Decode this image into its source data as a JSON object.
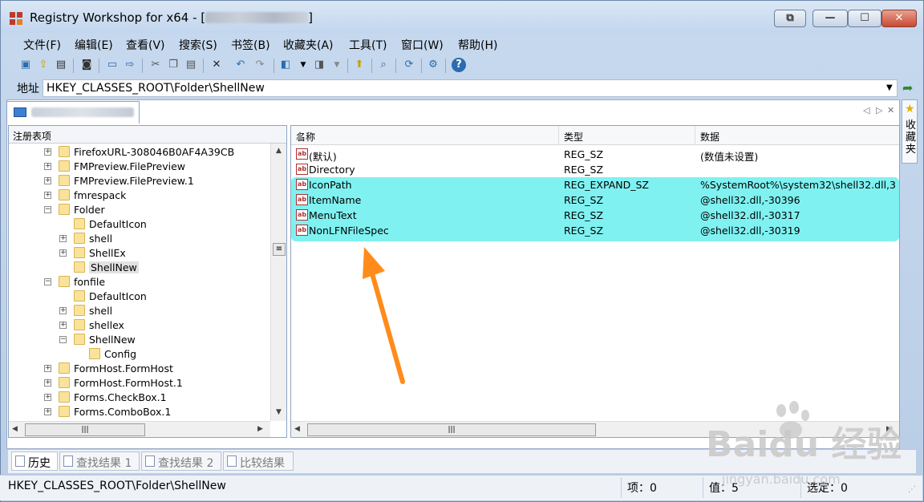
{
  "window": {
    "title": "Registry Workshop for x64 - [",
    "title_suffix": "]"
  },
  "menu": [
    "文件(F)",
    "编辑(E)",
    "查看(V)",
    "搜索(S)",
    "书签(B)",
    "收藏夹(A)",
    "工具(T)",
    "窗口(W)",
    "帮助(H)"
  ],
  "address": {
    "label": "地址",
    "value": "HKEY_CLASSES_ROOT\\Folder\\ShellNew"
  },
  "favorites": {
    "label": "收藏夹"
  },
  "tree": {
    "header": "注册表项",
    "items": [
      {
        "label": "FirefoxURL-308046B0AF4A39CB",
        "level": 0,
        "expander": "+"
      },
      {
        "label": "FMPreview.FilePreview",
        "level": 0,
        "expander": "+"
      },
      {
        "label": "FMPreview.FilePreview.1",
        "level": 0,
        "expander": "+"
      },
      {
        "label": "fmrespack",
        "level": 0,
        "expander": "+"
      },
      {
        "label": "Folder",
        "level": 0,
        "expander": "-"
      },
      {
        "label": "DefaultIcon",
        "level": 1,
        "expander": ""
      },
      {
        "label": "shell",
        "level": 1,
        "expander": "+"
      },
      {
        "label": "ShellEx",
        "level": 1,
        "expander": "+"
      },
      {
        "label": "ShellNew",
        "level": 1,
        "expander": "",
        "selected": true
      },
      {
        "label": "fonfile",
        "level": 0,
        "expander": "-"
      },
      {
        "label": "DefaultIcon",
        "level": 1,
        "expander": ""
      },
      {
        "label": "shell",
        "level": 1,
        "expander": "+"
      },
      {
        "label": "shellex",
        "level": 1,
        "expander": "+"
      },
      {
        "label": "ShellNew",
        "level": 1,
        "expander": "-"
      },
      {
        "label": "Config",
        "level": 2,
        "expander": ""
      },
      {
        "label": "FormHost.FormHost",
        "level": 0,
        "expander": "+"
      },
      {
        "label": "FormHost.FormHost.1",
        "level": 0,
        "expander": "+"
      },
      {
        "label": "Forms.CheckBox.1",
        "level": 0,
        "expander": "+"
      },
      {
        "label": "Forms.ComboBox.1",
        "level": 0,
        "expander": "+"
      }
    ]
  },
  "list": {
    "columns": [
      "名称",
      "类型",
      "数据"
    ],
    "rows": [
      {
        "name": "(默认)",
        "type": "REG_SZ",
        "data": "(数值未设置)"
      },
      {
        "name": "Directory",
        "type": "REG_SZ",
        "data": ""
      },
      {
        "name": "IconPath",
        "type": "REG_EXPAND_SZ",
        "data": "%SystemRoot%\\system32\\shell32.dll,3"
      },
      {
        "name": "ItemName",
        "type": "REG_SZ",
        "data": "@shell32.dll,-30396"
      },
      {
        "name": "MenuText",
        "type": "REG_SZ",
        "data": "@shell32.dll,-30317"
      },
      {
        "name": "NonLFNFileSpec",
        "type": "REG_SZ",
        "data": "@shell32.dll,-30319"
      }
    ]
  },
  "bottom_tabs": [
    "历史",
    "查找结果 1",
    "查找结果 2",
    "比较结果"
  ],
  "status": {
    "path": "HKEY_CLASSES_ROOT\\Folder\\ShellNew",
    "keys": "项：0",
    "values": "值：5",
    "selected": "选定：0"
  },
  "watermark": {
    "main": "Baidu 经验",
    "sub": "jingyan.baidu.com"
  },
  "colors": {
    "highlight": "#78f0f0",
    "arrow": "#ff8c1a",
    "accent": "#3d7fd0"
  }
}
